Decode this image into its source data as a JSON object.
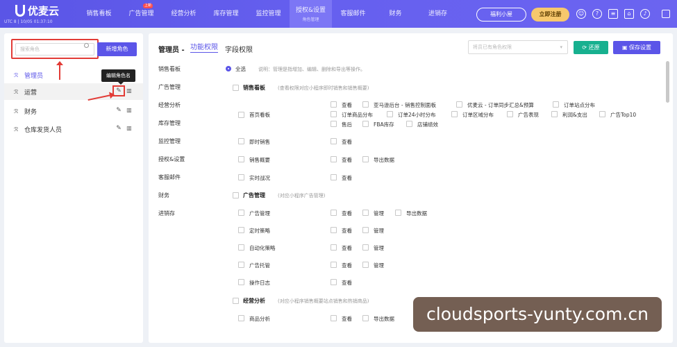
{
  "app": {
    "brand": "优麦云",
    "region_time": "UTC 8 | 10/05 01:37:10"
  },
  "nav": [
    {
      "label": "销售看板"
    },
    {
      "label": "广告管理",
      "badge": "上新"
    },
    {
      "label": "经营分析"
    },
    {
      "label": "库存管理"
    },
    {
      "label": "监控管理"
    },
    {
      "label": "授权&设置",
      "sub": "角色管理",
      "active": true
    },
    {
      "label": "客服邮件"
    },
    {
      "label": "财务"
    },
    {
      "label": "进销存"
    }
  ],
  "header_actions": {
    "welfare": "福利小屋",
    "register": "立即注册"
  },
  "left": {
    "search_placeholder": "搜索角色",
    "add_role": "新增角色",
    "tooltip": "编辑角色名",
    "roles": [
      {
        "label": "管理员"
      },
      {
        "label": "运营"
      },
      {
        "label": "财务"
      },
      {
        "label": "仓库发货人员"
      }
    ]
  },
  "right": {
    "title": "管理员 -",
    "tab_function": "功能权限",
    "tab_field": "字段权限",
    "role_select_placeholder": "将员已有角色权限",
    "restore": "还原",
    "save": "保存设置",
    "modules": [
      "销售看板",
      "广告管理",
      "经营分析",
      "库存管理",
      "监控管理",
      "授权&设置",
      "客服邮件",
      "财务",
      "进销存"
    ],
    "select_all": "全选",
    "note": "说明：管理是指增加、编辑、删除和导出等操作。",
    "sec1": {
      "title": "销售看板",
      "desc": "(查看权限对应小程序即时销售和销售概要)"
    },
    "row_home": "首页看板",
    "home_opts": [
      "查看",
      "亚马逊后台 - 销售控制面板",
      "优麦云 - 订单同步汇总&预算",
      "订单站点分布",
      "订单商品分布",
      "订单24小时分布",
      "订单区域分布",
      "广告表现",
      "利润&支出",
      "广告Top10",
      "售后",
      "FBA库存",
      "店铺绩效"
    ],
    "row_instant": "即时销售",
    "row_overview": "销售概要",
    "row_live": "实时战况",
    "view": "查看",
    "export": "导出数据",
    "manage": "管理",
    "sec2": {
      "title": "广告管理",
      "desc": "(对应小程序广告管理)"
    },
    "ad_rows": [
      "广告管理",
      "定时策略",
      "自动化策略",
      "广告托管",
      "操作日志"
    ],
    "sec3": {
      "title": "经营分析",
      "desc": "(对应小程序销售概要站点销售和热销商品)"
    },
    "row_product": "商品分析"
  },
  "watermark": "cloudsports-yunty.com.cn"
}
